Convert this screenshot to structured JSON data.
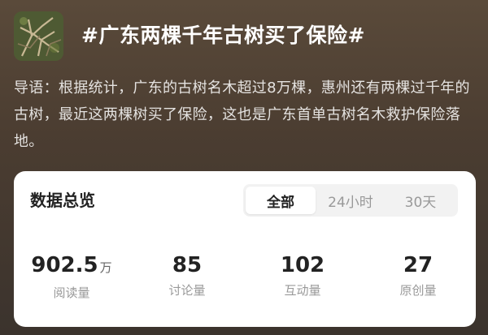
{
  "topic": {
    "title": "#广东两棵千年古树买了保险#",
    "avatar_icon": "tree-photo-thumbnail"
  },
  "intro": {
    "text": "导语：根据统计，广东的古树名木超过8万棵，惠州还有两棵过千年的古树，最近这两棵树买了保险，这也是广东首单古树名木救护保险落地。"
  },
  "overview": {
    "title": "数据总览",
    "tabs": [
      {
        "label": "全部",
        "active": true
      },
      {
        "label": "24小时",
        "active": false
      },
      {
        "label": "30天",
        "active": false
      }
    ],
    "stats": [
      {
        "value": "902.5",
        "unit": "万",
        "label": "阅读量"
      },
      {
        "value": "85",
        "unit": "",
        "label": "讨论量"
      },
      {
        "value": "102",
        "unit": "",
        "label": "互动量"
      },
      {
        "value": "27",
        "unit": "",
        "label": "原创量"
      }
    ]
  },
  "colors": {
    "background_top": "#5a4a3a",
    "card": "#ffffff",
    "title_text": "#ffffff"
  }
}
